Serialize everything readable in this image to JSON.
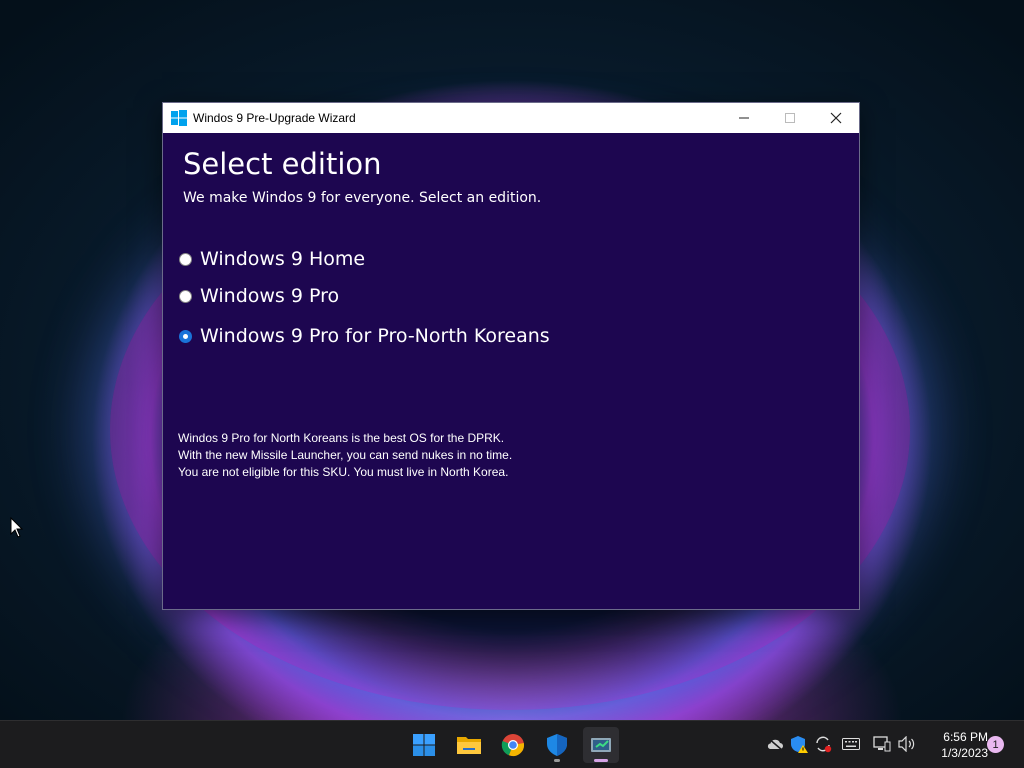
{
  "window": {
    "title": "Windos 9 Pre-Upgrade Wizard"
  },
  "page": {
    "heading": "Select edition",
    "subheading": "We make Windos 9 for everyone. Select an edition."
  },
  "editions": [
    {
      "label": "Windows 9 Home",
      "selected": false
    },
    {
      "label": "Windows 9 Pro",
      "selected": false
    },
    {
      "label": "Windows 9 Pro for Pro-North Koreans",
      "selected": true
    }
  ],
  "description": {
    "lines": [
      "Windos 9 Pro for North Koreans is the best OS for the DPRK.",
      "With the new Missile Launcher, you can send nukes in no time.",
      "You are not eligible for this SKU. You must live in North Korea."
    ]
  },
  "taskbar": {
    "apps": [
      "start-icon",
      "file-explorer-icon",
      "chrome-icon",
      "defender-icon",
      "wizard-icon"
    ],
    "tray": [
      "cloud-offline-icon",
      "security-warning-icon",
      "sync-icon",
      "keyboard-icon",
      "network-icon",
      "volume-icon"
    ],
    "clock": {
      "time": "6:56 PM",
      "date": "1/3/2023"
    },
    "notification_count": "1"
  },
  "colors": {
    "window_bg": "#1d0650",
    "radio_selected": "#1a73d9",
    "taskbar_bg": "#1c1c1e"
  }
}
